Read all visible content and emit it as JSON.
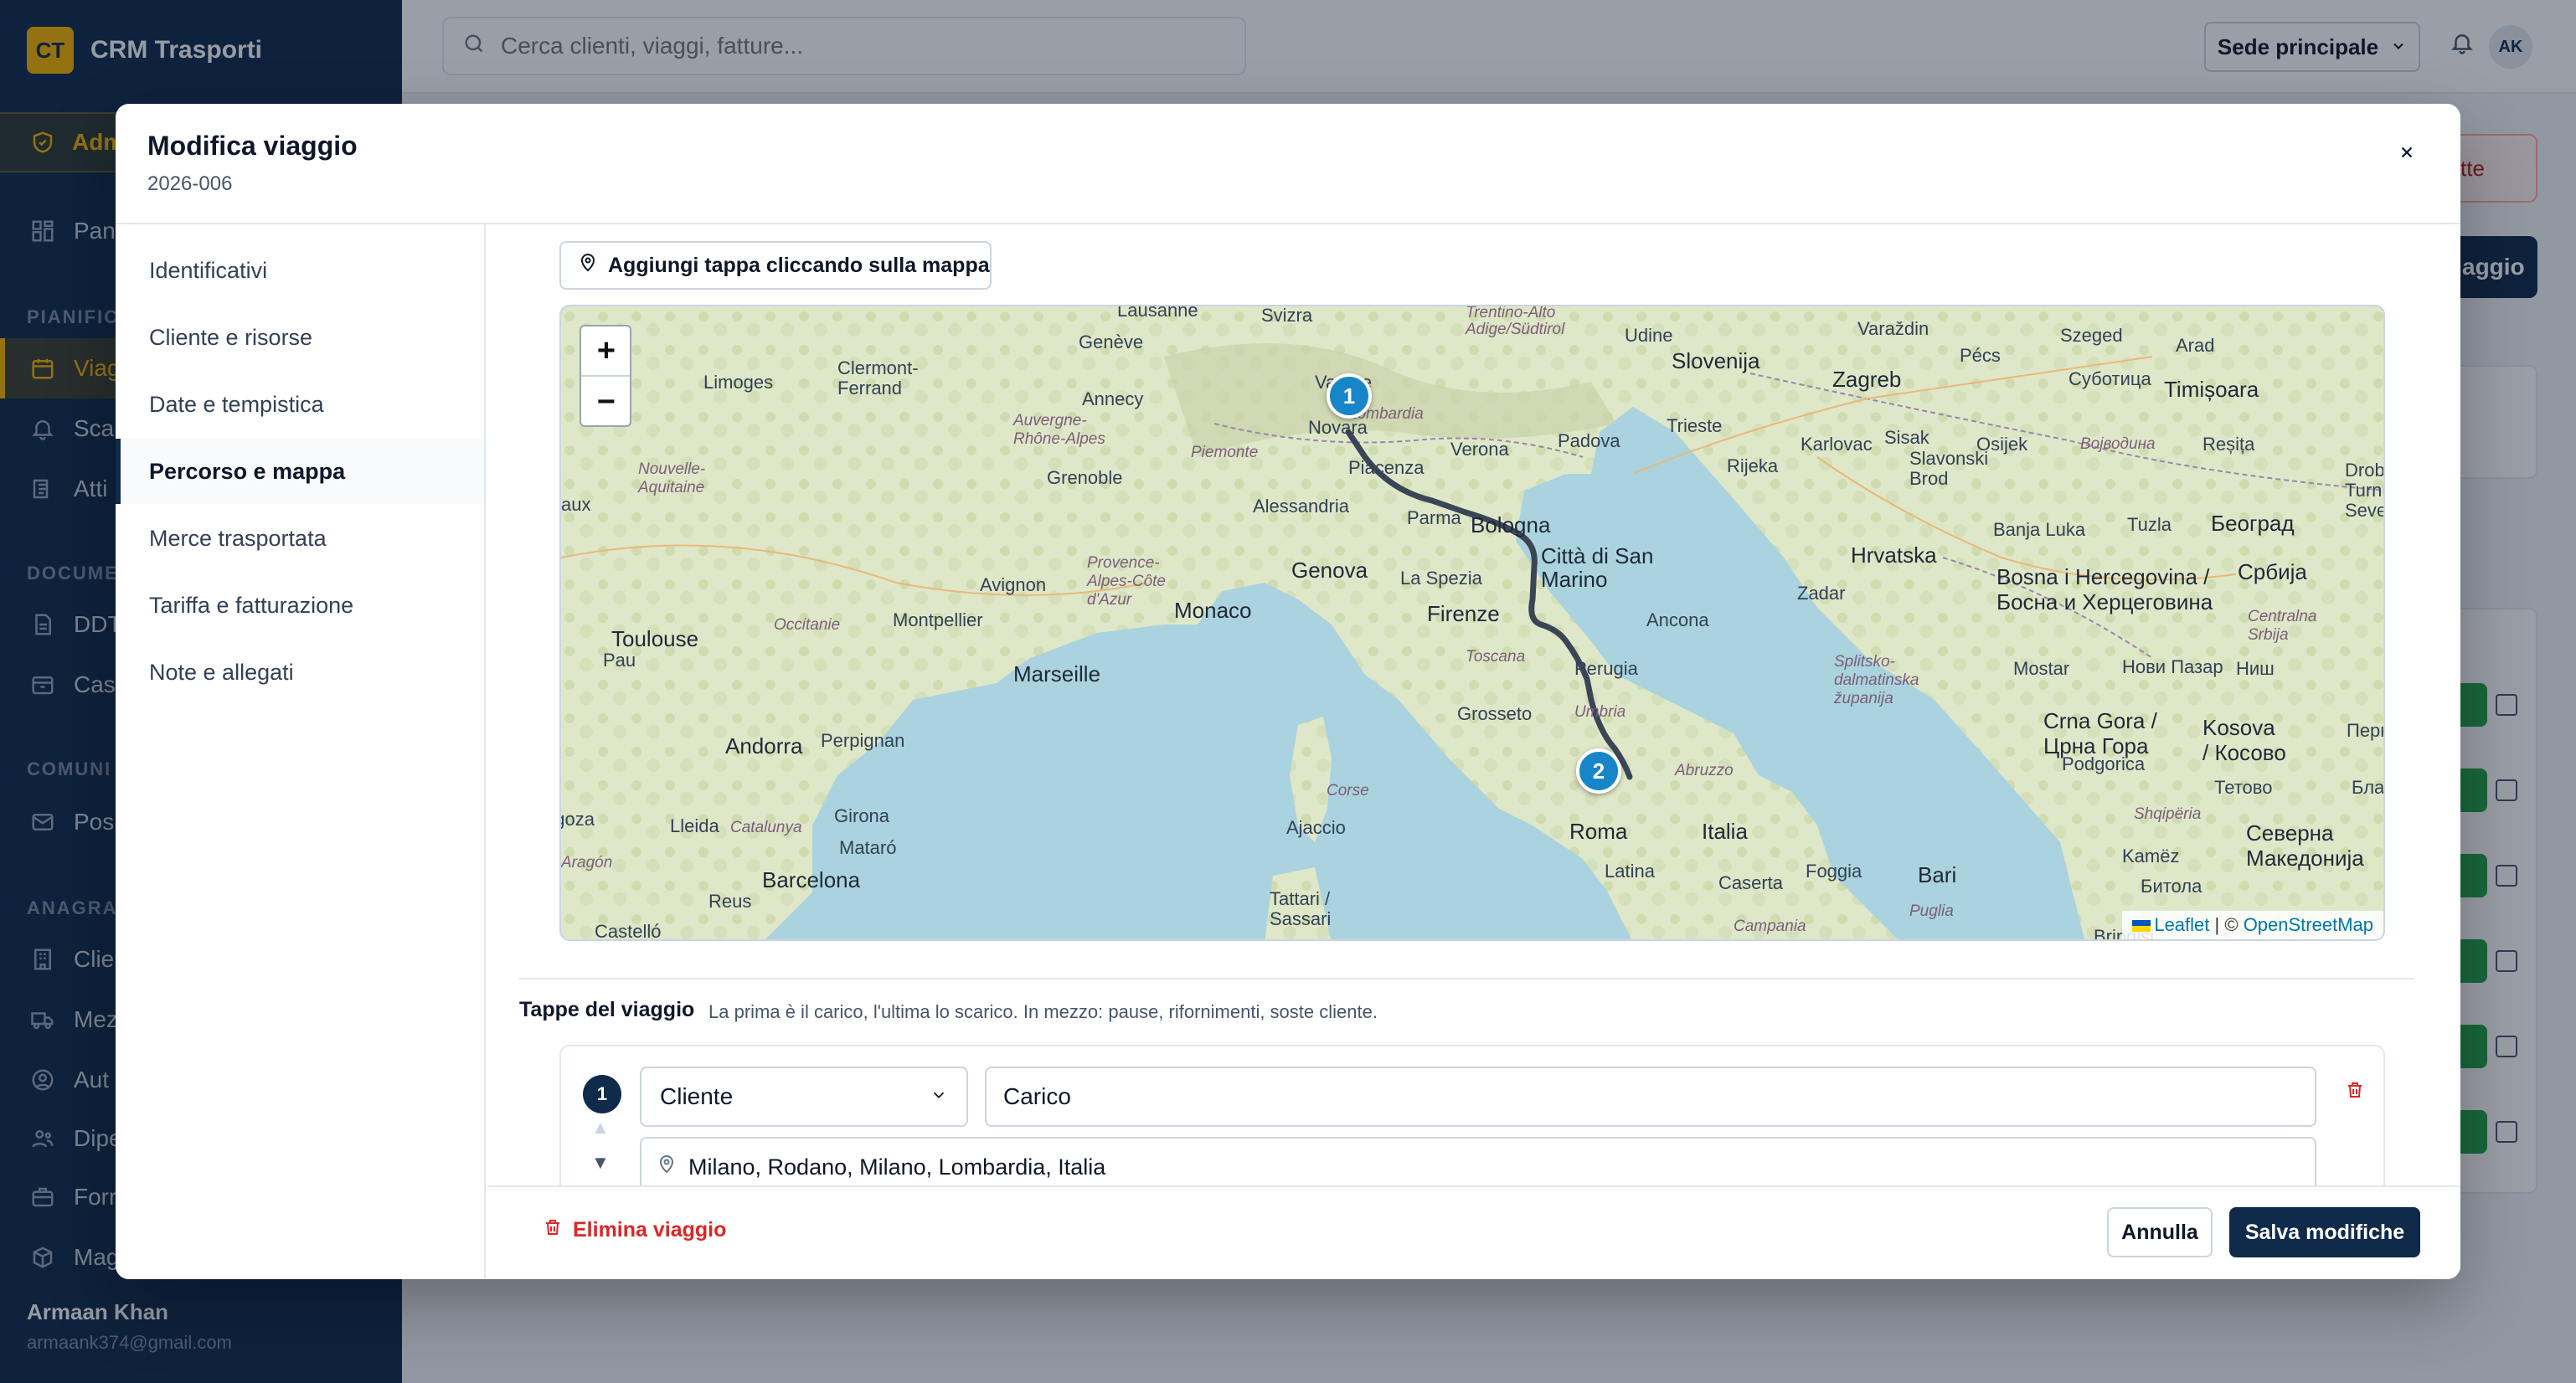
{
  "brand": {
    "logo": "CT",
    "name": "CRM Trasporti"
  },
  "sidebar": {
    "admin_label": "Adm",
    "items": [
      {
        "label": "Pan",
        "icon": "dashboard-icon"
      },
      {
        "label": "PIANIFIC",
        "type": "section"
      },
      {
        "label": "Viag",
        "icon": "calendar-icon",
        "active": true
      },
      {
        "label": "Sca",
        "icon": "bell-icon"
      },
      {
        "label": "Atti",
        "icon": "list-icon"
      },
      {
        "label": "DOCUME",
        "type": "section"
      },
      {
        "label": "DDT",
        "icon": "document-icon"
      },
      {
        "label": "Cas",
        "icon": "archive-icon"
      },
      {
        "label": "COMUNI",
        "type": "section"
      },
      {
        "label": "Pos",
        "icon": "mail-icon"
      },
      {
        "label": "ANAGRA",
        "type": "section"
      },
      {
        "label": "Clie",
        "icon": "building-icon"
      },
      {
        "label": "Mez",
        "icon": "truck-icon"
      },
      {
        "label": "Aut",
        "icon": "driver-icon"
      },
      {
        "label": "Dipe",
        "icon": "users-icon"
      },
      {
        "label": "Forr",
        "icon": "supplier-icon"
      },
      {
        "label": "Mag",
        "icon": "box-icon"
      }
    ],
    "user": {
      "name": "Armaan Khan",
      "email": "armaank374@gmail.com"
    }
  },
  "topbar": {
    "search_placeholder": "Cerca clienti, viaggi, fatture...",
    "branch": "Sede principale",
    "avatar": "AK"
  },
  "background": {
    "outline_button": "tte",
    "dark_button": "aggio"
  },
  "modal": {
    "title": "Modifica viaggio",
    "subtitle": "2026-006",
    "nav": [
      "Identificativi",
      "Cliente e risorse",
      "Date e tempistica",
      "Percorso e mappa",
      "Merce trasportata",
      "Tariffa e fatturazione",
      "Note e allegati"
    ],
    "active_nav": "Percorso e mappa",
    "add_stop_label": "Aggiungi tappa cliccando sulla mappa",
    "map": {
      "zoom_in": "+",
      "zoom_out": "−",
      "attribution_leaflet": "Leaflet",
      "attribution_sep": "| ©",
      "attribution_osm": "OpenStreetMap",
      "markers": [
        "1",
        "2"
      ],
      "cities": [
        "Lausanne",
        "Svizra",
        "Trentino-Alto Adige/Südtirol",
        "Udine",
        "Slovenija",
        "Varaždin",
        "Szeged",
        "Arad",
        "Pécs",
        "Genève",
        "Annecy",
        "Limoges",
        "Clermont-Ferrand",
        "Auvergne-Rhône-Alpes",
        "Lombardia",
        "Novara",
        "Piemonte",
        "Verona",
        "Padova",
        "Trieste",
        "Zagreb",
        "Karlovac",
        "Sisak",
        "Osijek",
        "Timișoara",
        "Суботица",
        "Војводина",
        "Reșița",
        "Rijeka",
        "Slavonski Brod",
        "Nouvelle-Aquitaine",
        "Grenoble",
        "Piacenza",
        "Alessandria",
        "Parma",
        "Bologna",
        "Città di San Marino",
        "Hrvatska",
        "Banja Luka",
        "Tuzla",
        "Београд",
        "Drobeta-Turnu Severin",
        "Provence-Alpes-Côte d'Azur",
        "Avignon",
        "Monaco",
        "Genova",
        "La Spezia",
        "Zadar",
        "Bosna i Hercegovina / Босна и Херцеговина",
        "Србија",
        "Toulouse",
        "Occitanie",
        "Montpellier",
        "Firenze",
        "Ancona",
        "Centralna Srbija",
        "Pau",
        "Marseille",
        "Toscana",
        "Perugia",
        "Splitsko-dalmatinska županija",
        "Mostar",
        "Нови Пазар",
        "Ниш",
        "Grosseto",
        "Umbria",
        "Crna Gora / Црна Гора",
        "Kosova / Косово",
        "Перник",
        "Andorra",
        "Perpignan",
        "Abruzzo",
        "Podgorica",
        "Тетово",
        "Бла",
        "Lleida",
        "Catalunya",
        "Girona",
        "Ajaccio",
        "Corse",
        "Roma",
        "Italia",
        "Shqipëria",
        "Северна Македонија",
        "agoza",
        "Aragón",
        "Mataró",
        "Kamëz",
        "Barcelona",
        "Reus",
        "Tattari / Sassari",
        "Latina",
        "Caserta",
        "Foggia",
        "Bari",
        "Битола",
        "Castelló",
        "Campania",
        "Puglia",
        "Brindisi",
        "Varese",
        "aux"
      ]
    },
    "stops_title": "Tappe del viaggio",
    "stops_hint": "La prima è il carico, l'ultima lo scarico. In mezzo: pause, rifornimenti, soste cliente.",
    "stops": [
      {
        "number": "1",
        "type": "Cliente",
        "name": "Carico",
        "address": "Milano, Rodano, Milano, Lombardia, Italia"
      }
    ],
    "delete_label": "Elimina viaggio",
    "cancel_label": "Annulla",
    "save_label": "Salva modifiche"
  }
}
